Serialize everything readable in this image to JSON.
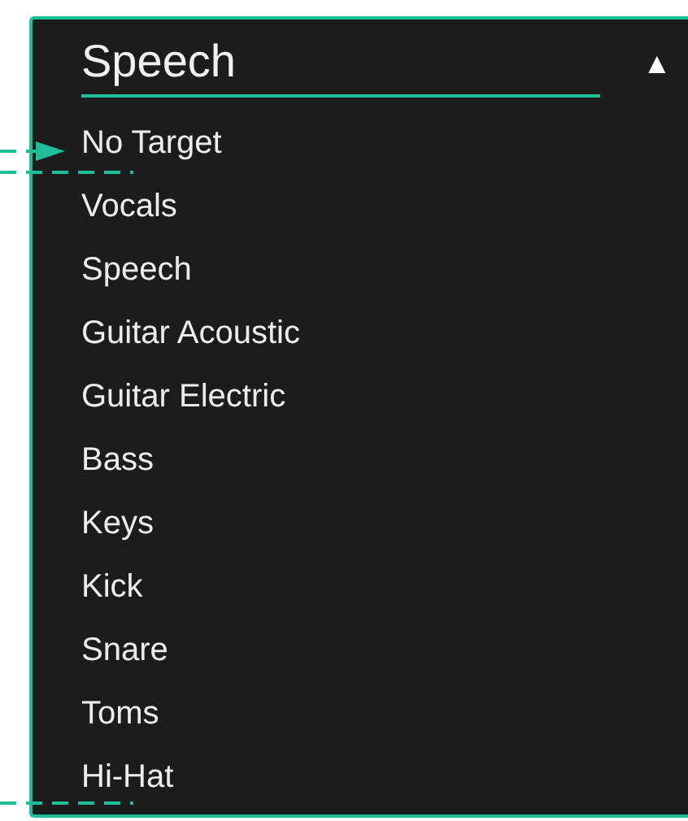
{
  "dropdown": {
    "value": "Speech",
    "caret": "▲",
    "expanded": true,
    "options": [
      {
        "label": "No Target",
        "pointed": true
      },
      {
        "label": "Vocals",
        "pointed": false
      },
      {
        "label": "Speech",
        "pointed": false
      },
      {
        "label": "Guitar Acoustic",
        "pointed": false
      },
      {
        "label": "Guitar Electric",
        "pointed": false
      },
      {
        "label": "Bass",
        "pointed": false
      },
      {
        "label": "Keys",
        "pointed": false
      },
      {
        "label": "Kick",
        "pointed": false
      },
      {
        "label": "Snare",
        "pointed": false
      },
      {
        "label": "Toms",
        "pointed": false
      },
      {
        "label": "Hi-Hat",
        "pointed": false
      }
    ]
  }
}
